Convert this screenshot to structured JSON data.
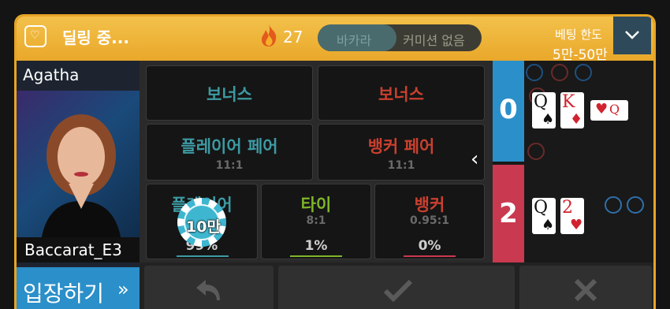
{
  "header": {
    "status": "딜링 중...",
    "fire_count": "27",
    "mode_toggle": {
      "option1": "바카라",
      "option2": "커미션 없음"
    },
    "limit_label": "베팅 한도",
    "limit_value": "5만-50만"
  },
  "dealer": {
    "name": "Agatha",
    "table": "Baccarat_E3",
    "enter_label": "입장하기"
  },
  "bets": {
    "player_bonus": "보너스",
    "banker_bonus": "보너스",
    "player_pair": {
      "label": "플레이어 페어",
      "odds": "11:1"
    },
    "banker_pair": {
      "label": "뱅커 페어",
      "odds": "11:1"
    },
    "player": {
      "label": "플레이어",
      "percent": "99%"
    },
    "tie": {
      "label": "타이",
      "odds": "8:1",
      "percent": "1%"
    },
    "banker": {
      "label": "뱅커",
      "odds": "0.95:1",
      "percent": "0%"
    }
  },
  "chip": {
    "value": "10만"
  },
  "result": {
    "player_score": "0",
    "banker_score": "2",
    "player_cards": [
      {
        "rank": "Q",
        "suit": "♠"
      },
      {
        "rank": "K",
        "suit": "♦"
      }
    ],
    "banker_cards": [
      {
        "rank": "Q",
        "suit": "♠"
      },
      {
        "rank": "2",
        "suit": "♥"
      }
    ]
  },
  "colors": {
    "gold": "#e9a82a",
    "player_blue": "#2b8fc9",
    "banker_red": "#c9394f",
    "teal": "#3d9aa3"
  },
  "icons": [
    "heart-card-icon",
    "fire-icon",
    "chevron-down-icon",
    "chevron-left-icon",
    "undo-icon",
    "check-icon",
    "close-icon",
    "double-chevron-right-icon",
    "heart-card-icon-small"
  ]
}
